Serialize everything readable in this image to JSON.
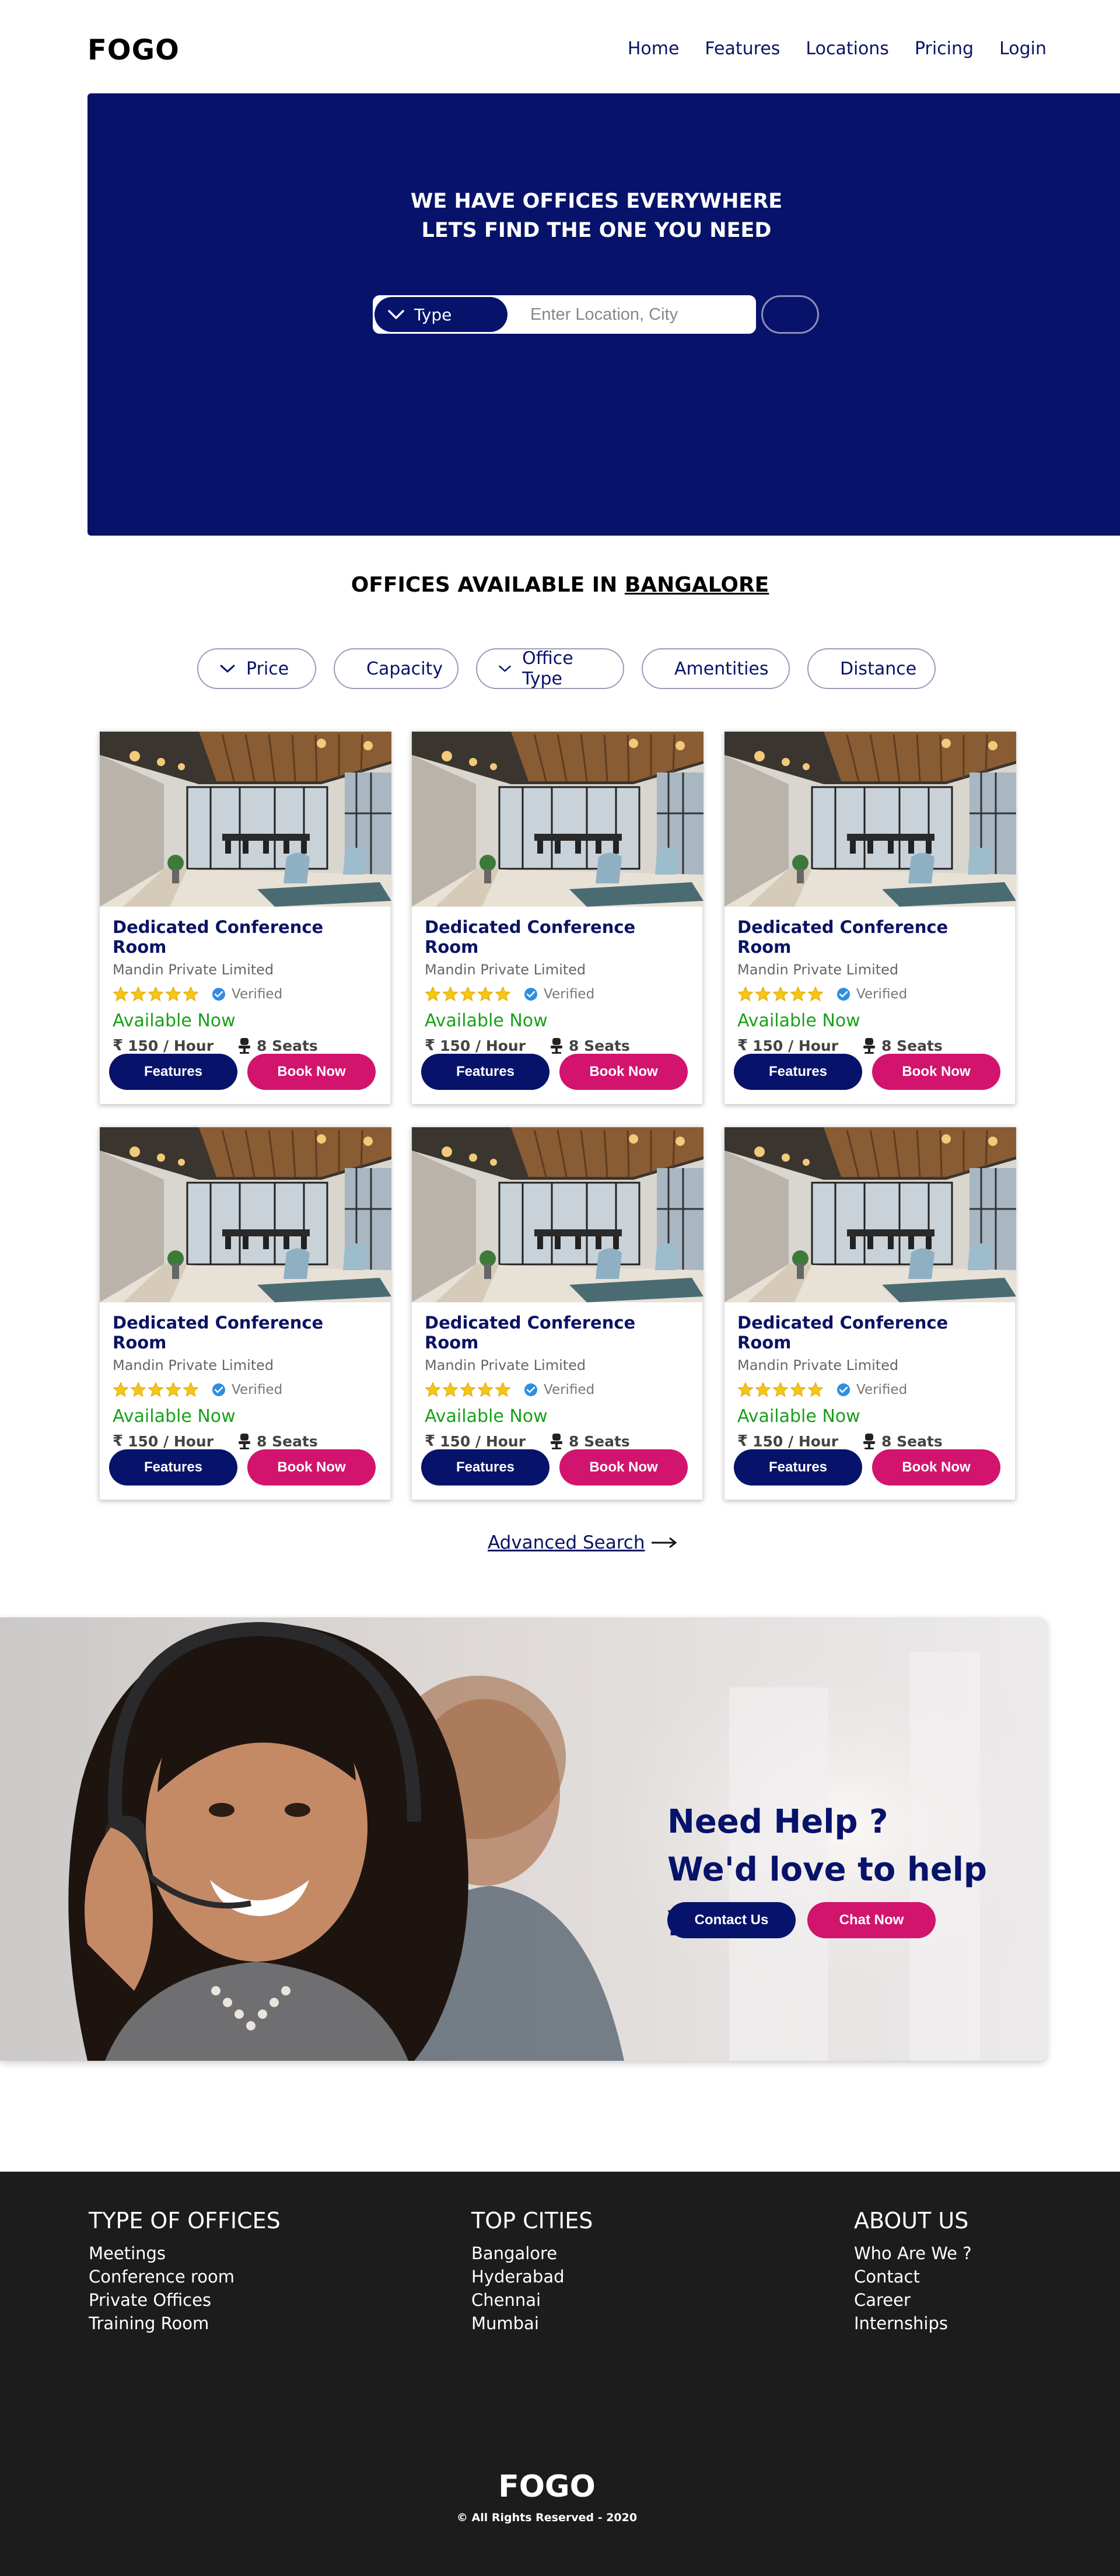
{
  "brand": "FOGO",
  "nav": {
    "home": "Home",
    "features": "Features",
    "locations": "Locations",
    "pricing": "Pricing",
    "login": "Login"
  },
  "hero": {
    "title_line1": "WE HAVE OFFICES EVERYWHERE",
    "title_line2": "LETS FIND THE ONE YOU NEED",
    "type_label": "Type",
    "search_placeholder": "Enter Location, City"
  },
  "offices": {
    "heading_prefix": "OFFICES AVAILABLE IN",
    "city": "BANGALORE"
  },
  "filters": [
    "Price",
    "Capacity",
    "Office Type",
    "Amentities",
    "Distance"
  ],
  "cards": [
    {
      "title": "Dedicated Conference Room",
      "company": "Mandin Private Limited",
      "rating": 5,
      "verified": "Verified",
      "availability": "Available Now",
      "price": "150 / Hour",
      "seats": "8 Seats",
      "features_btn": "Features",
      "book_btn": "Book Now"
    },
    {
      "title": "Dedicated Conference Room",
      "company": "Mandin Private Limited",
      "rating": 5,
      "verified": "Verified",
      "availability": "Available Now",
      "price": "150 / Hour",
      "seats": "8 Seats",
      "features_btn": "Features",
      "book_btn": "Book Now"
    },
    {
      "title": "Dedicated Conference Room",
      "company": "Mandin Private Limited",
      "rating": 5,
      "verified": "Verified",
      "availability": "Available Now",
      "price": "150 / Hour",
      "seats": "8 Seats",
      "features_btn": "Features",
      "book_btn": "Book Now"
    },
    {
      "title": "Dedicated Conference Room",
      "company": "Mandin Private Limited",
      "rating": 5,
      "verified": "Verified",
      "availability": "Available Now",
      "price": "150 / Hour",
      "seats": "8 Seats",
      "features_btn": "Features",
      "book_btn": "Book Now"
    },
    {
      "title": "Dedicated Conference Room",
      "company": "Mandin Private Limited",
      "rating": 5,
      "verified": "Verified",
      "availability": "Available Now",
      "price": "150 / Hour",
      "seats": "8 Seats",
      "features_btn": "Features",
      "book_btn": "Book Now"
    },
    {
      "title": "Dedicated Conference Room",
      "company": "Mandin Private Limited",
      "rating": 5,
      "verified": "Verified",
      "availability": "Available Now",
      "price": "150 / Hour",
      "seats": "8 Seats",
      "features_btn": "Features",
      "book_btn": "Book Now"
    }
  ],
  "advanced_search": "Advanced Search",
  "help": {
    "line1": "Need Help ?",
    "line2": "We'd love to help you.",
    "contact_btn": "Contact Us",
    "chat_btn": "Chat Now"
  },
  "footer": {
    "col1": {
      "title": "TYPE OF OFFICES",
      "links": [
        "Meetings",
        "Conference room",
        "Private Offices",
        "Training Room"
      ]
    },
    "col2": {
      "title": "TOP CITIES",
      "links": [
        "Bangalore",
        "Hyderabad",
        "Chennai",
        "Mumbai"
      ]
    },
    "col3": {
      "title": "ABOUT US",
      "links": [
        "Who Are We ?",
        "Contact",
        "Career",
        "Internships"
      ]
    },
    "logo": "FOGO",
    "copyright": "© All Rights Reserved - 2020"
  },
  "colors": {
    "navy": "#07136a",
    "pink": "#d2146e",
    "green": "#18a018",
    "star": "#f5c518",
    "footer_bg": "#1c1c1c"
  }
}
